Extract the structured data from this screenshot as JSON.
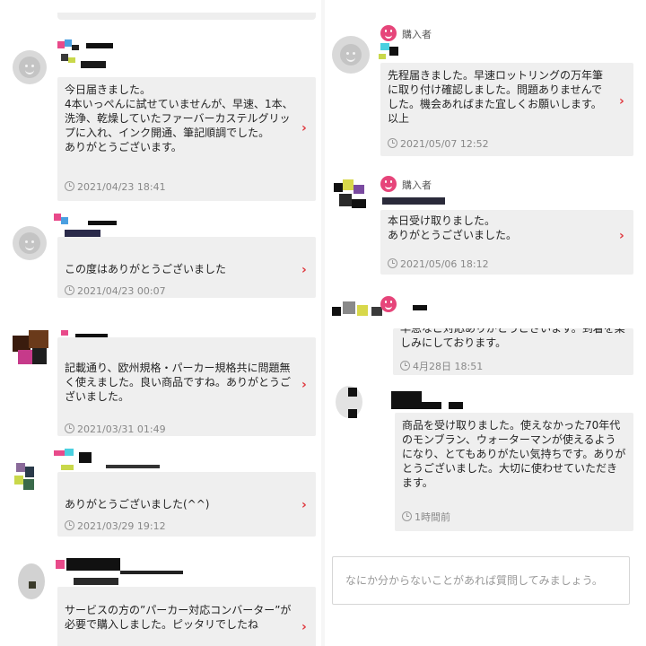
{
  "left_reviews": [
    {
      "text": "今日届きました。\n4本いっぺんに試せていませんが、早速、1本、洗浄、乾燥していたファーバーカステルグリップに入れ、インク開通、筆記順調でした。\nありがとうございます。",
      "date": "2021/04/23 18:41"
    },
    {
      "text": "この度はありがとうございました",
      "date": "2021/04/23 00:07"
    },
    {
      "text": "記載通り、欧州規格・パーカー規格共に問題無く使えました。良い商品ですね。ありがとうございました。",
      "date": "2021/03/31 01:49"
    },
    {
      "text": "ありがとうございました(^^)",
      "date": "2021/03/29 19:12"
    },
    {
      "text": "サービスの方の”パーカー対応コンバーター”が必要で購入しました。ピッタリでしたね",
      "date": ""
    }
  ],
  "right_messages": [
    {
      "buyer_label": "購入者",
      "text": "先程届きました。早速ロットリングの万年筆に取り付け確認しました。問題ありませんでした。機会あればまた宜しくお願いします。\n以上",
      "date": "2021/05/07 12:52"
    },
    {
      "buyer_label": "購入者",
      "text": "本日受け取りました。\nありがとうございました。",
      "date": "2021/05/06 18:12"
    },
    {
      "text": "早急なご対応ありがとうございます。到着を楽しみにしております。",
      "date": "4月28日 18:51"
    },
    {
      "text": "商品を受け取りました。使えなかった70年代のモンブラン、ウォーターマンが使えるようになり、とてもありがたい気持ちです。ありがとうございました。大切に使わせていただきます。",
      "date": "1時間前"
    }
  ],
  "question_input": {
    "placeholder": "なにか分からないことがあれば質問してみましょう。"
  },
  "colors": {
    "accent_red": "#e0383e",
    "buyer_pink": "#e6457a",
    "bubble_gray": "#efefef",
    "meta_gray": "#888888"
  },
  "icons": {
    "avatar": "default-user-avatar-icon",
    "chevron": "chevron-right-icon",
    "clock": "clock-icon",
    "buyer": "buyer-smile-icon"
  }
}
